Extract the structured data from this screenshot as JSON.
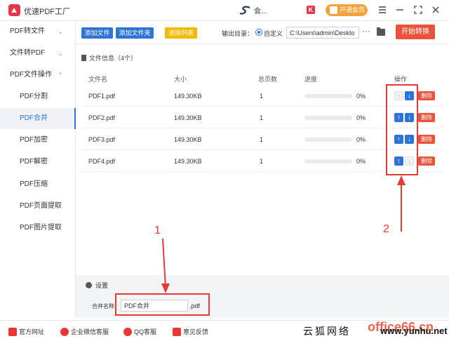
{
  "app": {
    "title": "优速PDF工厂",
    "user_name": "会...",
    "vip_label": "开通会员",
    "k_badge": "K"
  },
  "sidebar": {
    "items": [
      {
        "label": "PDF转文件",
        "chevron": "⌄"
      },
      {
        "label": "文件转PDF",
        "chevron": "⌄"
      },
      {
        "label": "PDF文件操作",
        "chevron": "⌃"
      },
      {
        "label": "PDF分割"
      },
      {
        "label": "PDF合并",
        "active": true
      },
      {
        "label": "PDF加密"
      },
      {
        "label": "PDF解密"
      },
      {
        "label": "PDF压缩"
      },
      {
        "label": "PDF页面提取"
      },
      {
        "label": "PDF图片提取"
      }
    ]
  },
  "toolbar": {
    "add_file": "添加文件",
    "add_folder": "添加文件夹",
    "clear_list": "清除列表",
    "output_label": "输出目录：",
    "custom_label": "自定义",
    "output_path": "C:\\Users\\admin\\Deskto",
    "more": "···",
    "start": "开始转换"
  },
  "files": {
    "header": "文件信息（4个）",
    "columns": {
      "name": "文件名",
      "size": "大小",
      "pages": "总页数",
      "progress": "进度",
      "actions": "操作"
    },
    "delete_label": "删除",
    "rows": [
      {
        "name": "PDF1.pdf",
        "size": "149.30KB",
        "pages": "1",
        "progress_text": "0%",
        "progress": 0,
        "up_enabled": false,
        "down_enabled": true
      },
      {
        "name": "PDF2.pdf",
        "size": "149.30KB",
        "pages": "1",
        "progress_text": "0%",
        "progress": 0,
        "up_enabled": true,
        "down_enabled": true
      },
      {
        "name": "PDF3.pdf",
        "size": "149.30KB",
        "pages": "1",
        "progress_text": "0%",
        "progress": 0,
        "up_enabled": true,
        "down_enabled": true
      },
      {
        "name": "PDF4.pdf",
        "size": "149.30KB",
        "pages": "1",
        "progress_text": "0%",
        "progress": 0,
        "up_enabled": true,
        "down_enabled": false
      }
    ]
  },
  "annotations": {
    "label_1": "1",
    "label_2": "2",
    "color": "#e53935"
  },
  "settings": {
    "title": "设置",
    "merge_label": "合并名称",
    "merge_value": "PDF合并",
    "merge_suffix": ".pdf"
  },
  "footer": {
    "links": [
      "官方网址",
      "企业微信客服",
      "QQ客服",
      "意见反馈"
    ]
  },
  "watermark": {
    "cn": "云狐网络",
    "url": "www.yunhu.net",
    "office": "office66.cn"
  },
  "colors": {
    "accent_blue": "#2d74d6",
    "accent_red": "#e8533a",
    "vip_orange": "#f2a33a"
  }
}
